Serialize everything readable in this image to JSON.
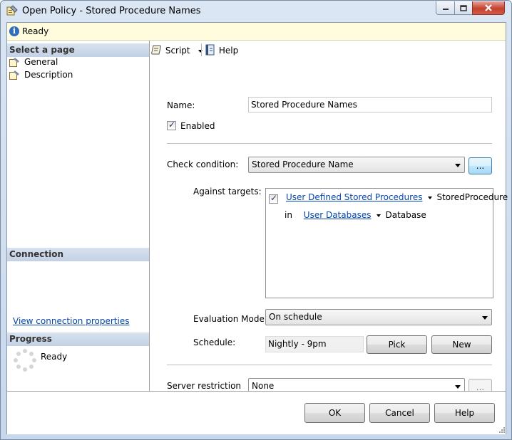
{
  "window": {
    "title": "Open Policy - Stored Procedure Names"
  },
  "status": {
    "text": "Ready"
  },
  "left": {
    "select_page_header": "Select a page",
    "pages": [
      {
        "label": "General",
        "icon": "page-wrench-icon"
      },
      {
        "label": "Description",
        "icon": "page-wrench-icon"
      }
    ],
    "connection_header": "Connection",
    "view_connection_link": "View connection properties",
    "progress_header": "Progress",
    "progress_status": "Ready"
  },
  "toolbar": {
    "script_label": "Script",
    "help_label": "Help"
  },
  "form": {
    "name_label": "Name:",
    "name_value": "Stored Procedure Names",
    "enabled_label": "Enabled",
    "enabled_checked": true,
    "check_condition_label": "Check condition:",
    "check_condition_value": "Stored Procedure Name",
    "ellipsis_label": "...",
    "against_targets_label": "Against targets:",
    "targets": {
      "row1_link": "User Defined Stored Procedures",
      "row1_type": "StoredProcedure",
      "row2_in": "in",
      "row2_link": "User Databases",
      "row2_type": "Database"
    },
    "evaluation_mode_label": "Evaluation Mode:",
    "evaluation_mode_value": "On schedule",
    "schedule_label": "Schedule:",
    "schedule_value": "Nightly - 9pm",
    "pick_label": "Pick",
    "new_label": "New",
    "server_restriction_label": "Server restriction",
    "server_restriction_value": "None",
    "server_ellipsis_label": "..."
  },
  "footer": {
    "ok_label": "OK",
    "cancel_label": "Cancel",
    "help_label": "Help"
  }
}
